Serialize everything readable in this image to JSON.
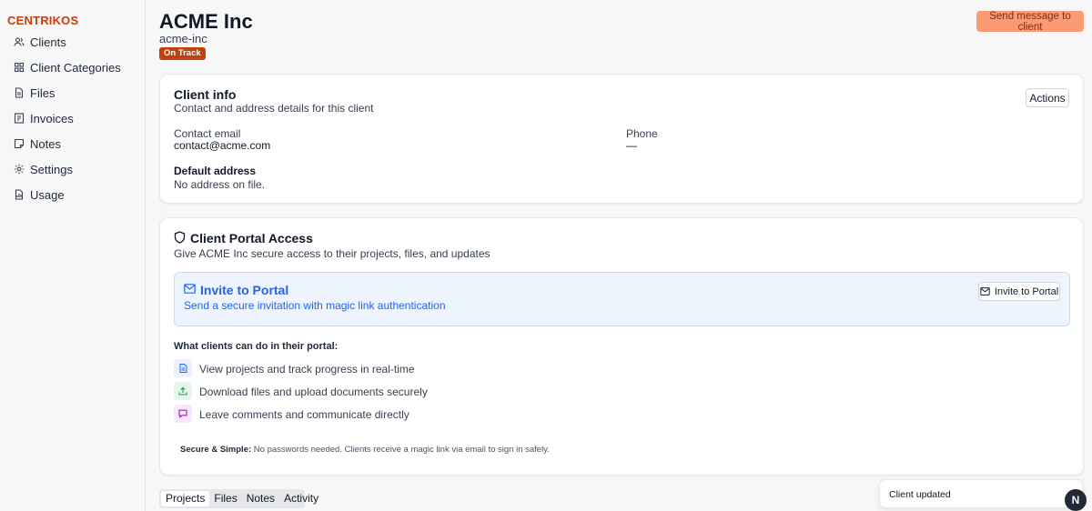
{
  "brand": "CENTRIKOS",
  "sidebar": {
    "items": [
      {
        "label": "Clients",
        "icon": "users-icon"
      },
      {
        "label": "Client Categories",
        "icon": "grid-icon"
      },
      {
        "label": "Files",
        "icon": "file-icon"
      },
      {
        "label": "Invoices",
        "icon": "invoice-icon"
      },
      {
        "label": "Notes",
        "icon": "note-icon"
      },
      {
        "label": "Settings",
        "icon": "gear-icon"
      },
      {
        "label": "Usage",
        "icon": "usage-icon"
      }
    ]
  },
  "header": {
    "title": "ACME Inc",
    "slug": "acme-inc",
    "badge": "On Track",
    "send_button": "Send message to client"
  },
  "client_info": {
    "title": "Client info",
    "subtitle": "Contact and address details for this client",
    "actions_label": "Actions",
    "email_label": "Contact email",
    "email_value": "contact@acme.com",
    "phone_label": "Phone",
    "phone_value": "—",
    "address_label": "Default address",
    "address_value": "No address on file."
  },
  "portal": {
    "title": "Client Portal Access",
    "subtitle": "Give ACME Inc secure access to their projects, files, and updates",
    "invite_title": "Invite to Portal",
    "invite_subtitle": "Send a secure invitation with magic link authentication",
    "invite_button": "Invite to Portal",
    "features_heading": "What clients can do in their portal:",
    "features": [
      {
        "text": "View projects and track progress in real-time",
        "icon": "document-icon"
      },
      {
        "text": "Download files and upload documents securely",
        "icon": "upload-icon"
      },
      {
        "text": "Leave comments and communicate directly",
        "icon": "chat-icon"
      }
    ],
    "secure_label": "Secure & Simple:",
    "secure_text": "No passwords needed. Clients receive a magic link via email to sign in safely."
  },
  "tabs": [
    "Projects",
    "Files",
    "Notes",
    "Activity"
  ],
  "toast": "Client updated",
  "avatar_letter": "N",
  "colors": {
    "brand": "#c2410c",
    "send_button": "#fb9a73",
    "invite_blue": "#2563eb",
    "invite_bg": "#eef4fd"
  }
}
